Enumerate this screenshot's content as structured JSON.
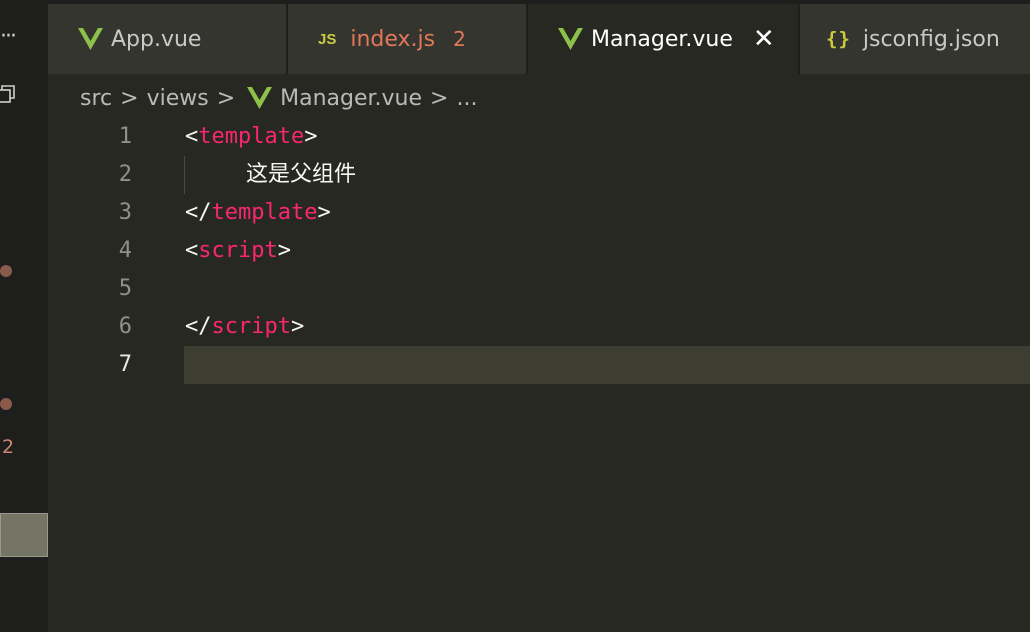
{
  "sidebar": {
    "problem_count": "2"
  },
  "tabs": [
    {
      "label": "App.vue",
      "icon": "vue-icon"
    },
    {
      "label": "index.js",
      "icon": "js-icon",
      "icon_text": "JS",
      "badge": "2"
    },
    {
      "label": "Manager.vue",
      "icon": "vue-icon",
      "active": true
    },
    {
      "label": "jsconfig.json",
      "icon": "json-icon",
      "icon_text": "{}"
    }
  ],
  "breadcrumb": {
    "part1": "src",
    "part2": "views",
    "part3": "Manager.vue",
    "part4": "...",
    "separator": ">"
  },
  "editor": {
    "lines": [
      {
        "number": "1",
        "open": "<",
        "tag": "template",
        "close": ">"
      },
      {
        "number": "2",
        "text": "这是父组件"
      },
      {
        "number": "3",
        "open": "</",
        "tag": "template",
        "close": ">"
      },
      {
        "number": "4",
        "open": "<",
        "tag": "script",
        "close": ">"
      },
      {
        "number": "5"
      },
      {
        "number": "6",
        "open": "</",
        "tag": "script",
        "close": ">"
      },
      {
        "number": "7"
      }
    ],
    "current_line": "7"
  },
  "colors": {
    "background": "#272822",
    "tag": "#f92672",
    "vue_green": "#8dc149",
    "json_yellow": "#cbcb41",
    "modified": "#e2785a"
  }
}
